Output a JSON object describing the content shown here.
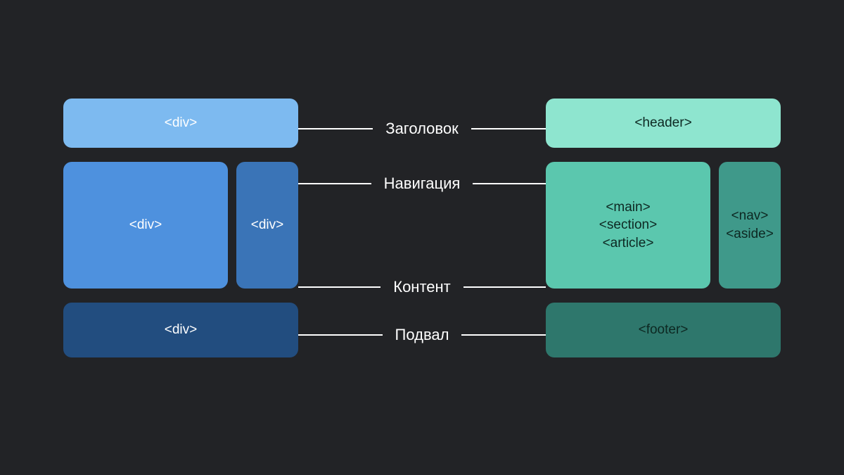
{
  "left": {
    "header": "<div>",
    "main": "<div>",
    "nav": "<div>",
    "footer": "<div>"
  },
  "right": {
    "header": "<header>",
    "main": "<main>\n<section>\n<article>",
    "nav": "<nav>\n<aside>",
    "footer": "<footer>"
  },
  "labels": {
    "header": "Заголовок",
    "nav": "Навигация",
    "content": "Контент",
    "footer": "Подвал"
  }
}
